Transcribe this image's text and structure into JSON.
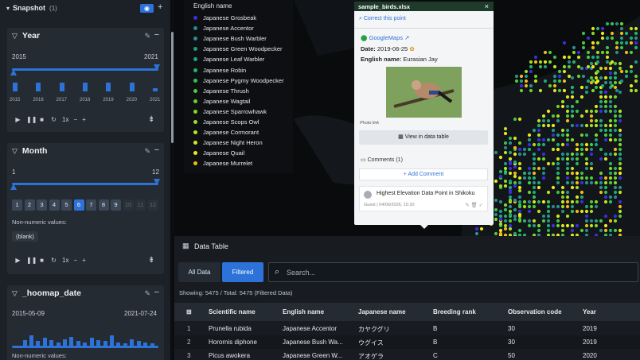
{
  "snapshot": {
    "title": "Snapshot",
    "count": "(1)",
    "camera_icon": "camera-icon",
    "plus": "+"
  },
  "year_card": {
    "title": "Year",
    "min": "2015",
    "max": "2021",
    "ticks": [
      "2015",
      "2016",
      "2017",
      "2018",
      "2019",
      "2020",
      "2021"
    ],
    "histogram": [
      0.9,
      0.9,
      0.9,
      0.9,
      0.9,
      0.9,
      0.3
    ],
    "speed": "1x"
  },
  "month_card": {
    "title": "Month",
    "min": "1",
    "max": "12",
    "months": [
      "1",
      "2",
      "3",
      "4",
      "5",
      "6",
      "7",
      "8",
      "9",
      "10",
      "11",
      "12"
    ],
    "active_month": "6",
    "non_numeric_label": "Non-numeric values:",
    "blank_pill": "(blank)",
    "speed": "1x"
  },
  "date_card": {
    "title": "_hoomap_date",
    "min": "2015-05-09",
    "max": "2021-07-24",
    "non_numeric_label": "Non-numeric values:",
    "histogram": [
      0.5,
      0.9,
      0.4,
      0.7,
      0.5,
      0.3,
      0.6,
      0.8,
      0.4,
      0.3,
      0.7,
      0.5,
      0.4,
      0.9,
      0.3,
      0.2,
      0.6,
      0.4,
      0.3,
      0.2
    ]
  },
  "legend": {
    "title": "English name",
    "items": [
      {
        "label": "Japanese Grosbeak",
        "color": "#3a2fe0"
      },
      {
        "label": "Japanese Accentor",
        "color": "#2a8a8a"
      },
      {
        "label": "Japanese Bush Warbler",
        "color": "#2a9090"
      },
      {
        "label": "Japanese Green Woodpecker",
        "color": "#239a86"
      },
      {
        "label": "Japanese Leaf Warbler",
        "color": "#1fa87a"
      },
      {
        "label": "Japanese Robin",
        "color": "#23b46a"
      },
      {
        "label": "Japanese Pygmy Woodpecker",
        "color": "#36c052"
      },
      {
        "label": "Japanese Thrush",
        "color": "#4ec83c"
      },
      {
        "label": "Japanese Wagtail",
        "color": "#6ad02c"
      },
      {
        "label": "Japanese Sparrowhawk",
        "color": "#84d826"
      },
      {
        "label": "Japanese Scops Owl",
        "color": "#a2dd22"
      },
      {
        "label": "Japanese Cormorant",
        "color": "#bce222"
      },
      {
        "label": "Japanese Night Heron",
        "color": "#d8e61e"
      },
      {
        "label": "Japanese Quail",
        "color": "#f0e81c"
      },
      {
        "label": "Japanese Murrelet",
        "color": "#f2b81a"
      }
    ]
  },
  "popup": {
    "file": "sample_birds.xlsx",
    "close": "×",
    "correct": "Correct this point",
    "gmaps": "GoogleMaps",
    "date_label": "Date:",
    "date_value": "2019-06-25",
    "name_label": "English name:",
    "name_value": "Eurasian Jay",
    "photo_caption": "Photo link",
    "view_button": "View in data table",
    "comments": "Comments (1)",
    "add_comment": "+ Add Comment",
    "comment_text": "Highest Elevation Data Point in Shikoku",
    "comment_meta": "Guest | 04/06/2026, 15:20"
  },
  "table": {
    "title": "Data Table",
    "tabs": {
      "all": "All Data",
      "filtered": "Filtered"
    },
    "search_placeholder": "Search...",
    "showing": "Showing: 5475 / Total: 5475 (Filtered Data)",
    "columns": [
      "Scientific name",
      "English name",
      "Japanese name",
      "Breeding rank",
      "Observation code",
      "Year"
    ],
    "rows": [
      {
        "idx": "1",
        "cells": [
          "Prunella rubida",
          "Japanese Accentor",
          "カヤクグリ",
          "B",
          "30",
          "2019"
        ]
      },
      {
        "idx": "2",
        "cells": [
          "Horornis diphone",
          "Japanese Bush Wa...",
          "ウグイス",
          "B",
          "30",
          "2019"
        ]
      },
      {
        "idx": "3",
        "cells": [
          "Picus awokera",
          "Japanese Green W...",
          "アオゲラ",
          "C",
          "50",
          "2020"
        ]
      }
    ]
  }
}
